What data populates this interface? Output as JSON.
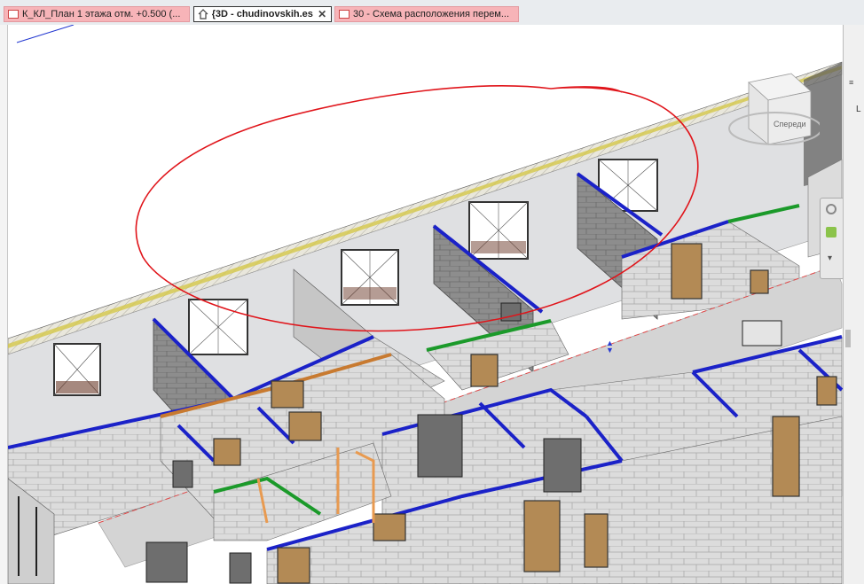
{
  "tabs": [
    {
      "label": "К_КЛ_План 1 этажа  отм. +0.500 (...",
      "active": false,
      "color": "#f7b4b8"
    },
    {
      "label": "{3D - chudinovskih.es}",
      "active": true,
      "color": "#ffffff"
    },
    {
      "label": "30 - Схема расположения перем...",
      "active": false,
      "color": "#f7b4b8"
    }
  ],
  "viewcube": {
    "label": "Спереди"
  },
  "rightpanel": {
    "letter": "L"
  },
  "colors": {
    "markup": "#e0141a",
    "wall_blue": "#1b22c8",
    "wall_green": "#1b9a2a",
    "floor": "#d7d5c8",
    "block": "#dddddd",
    "door": "#b38a55"
  }
}
